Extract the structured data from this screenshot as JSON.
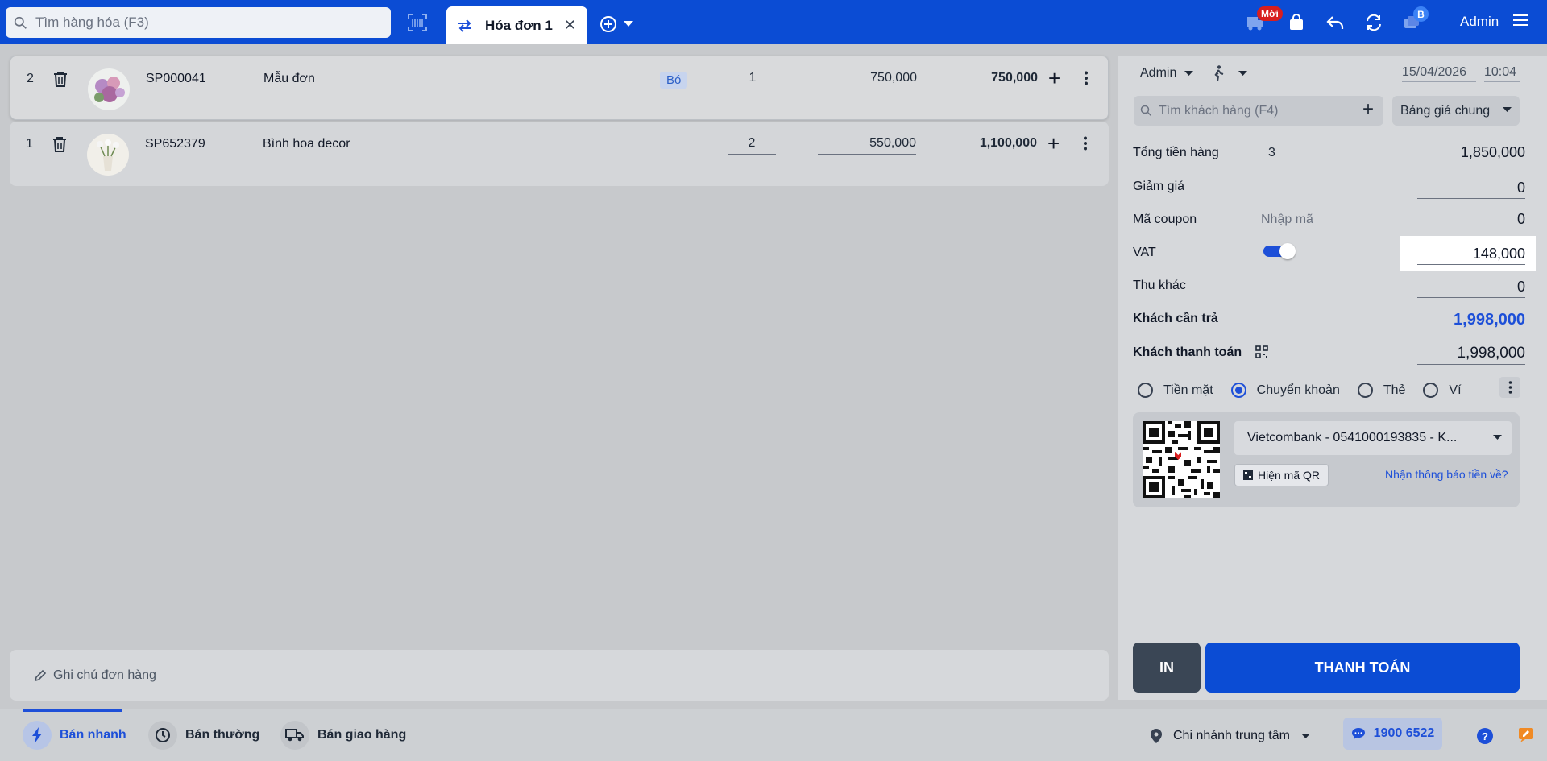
{
  "header": {
    "search_placeholder": "Tìm hàng hóa (F3)",
    "tab_label": "Hóa đơn 1",
    "tab_close": "✕",
    "badge_new": "Mới",
    "badge_b": "B",
    "user": "Admin",
    "icons": [
      "search-icon",
      "barcode-icon",
      "swap-icon",
      "close-icon",
      "add-circle-icon",
      "caret-down-icon",
      "delivery-icon",
      "bag-icon",
      "return-icon",
      "refresh-icon",
      "notification-icon",
      "menu-icon"
    ]
  },
  "cart": {
    "rows": [
      {
        "index": "2",
        "code": "SP000041",
        "name": "Mẫu đơn",
        "tag": "Bó",
        "qty": "1",
        "price": "750,000",
        "total": "750,000"
      },
      {
        "index": "1",
        "code": "SP652379",
        "name": "Bình hoa decor",
        "tag": "",
        "qty": "2",
        "price": "550,000",
        "total": "1,100,000"
      }
    ],
    "note_placeholder": "Ghi chú đơn hàng"
  },
  "panel": {
    "seller": "Admin",
    "date": "15/04/2026",
    "time": "10:04",
    "customer_search_placeholder": "Tìm khách hàng (F4)",
    "price_book": "Bảng giá chung",
    "summary": {
      "subtotal_label": "Tổng tiền hàng",
      "subtotal_count": "3",
      "subtotal_value": "1,850,000",
      "discount_label": "Giảm giá",
      "discount_value": "0",
      "coupon_label": "Mã coupon",
      "coupon_placeholder": "Nhập mã",
      "coupon_value": "0",
      "vat_label": "VAT",
      "vat_enabled": true,
      "vat_value": "148,000",
      "other_label": "Thu khác",
      "other_value": "0",
      "due_label": "Khách cần trả",
      "due_value": "1,998,000",
      "paid_label": "Khách thanh toán",
      "paid_value": "1,998,000"
    },
    "payment_methods": [
      {
        "label": "Tiền mặt",
        "selected": false
      },
      {
        "label": "Chuyển khoản",
        "selected": true
      },
      {
        "label": "Thẻ",
        "selected": false
      },
      {
        "label": "Ví",
        "selected": false
      }
    ],
    "bank": "Vietcombank - 0541000193835 - K...",
    "show_qr": "Hiện mã QR",
    "notify_link": "Nhận thông báo tiền về?",
    "print_label": "IN",
    "pay_label": "THANH TOÁN"
  },
  "footer": {
    "modes": [
      "Bán nhanh",
      "Bán thường",
      "Bán giao hàng"
    ],
    "branch": "Chi nhánh trung tâm",
    "hotline": "1900 6522",
    "help": "?"
  },
  "colors": {
    "brand": "#0b4cd4",
    "accent": "#1d4fd8",
    "new_badge": "#d81e1e"
  }
}
